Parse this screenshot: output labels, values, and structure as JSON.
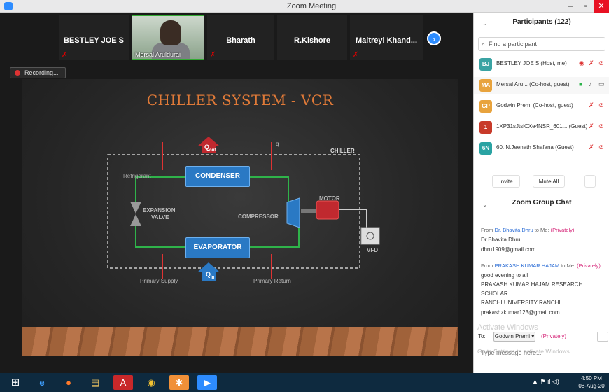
{
  "window": {
    "title": "Zoom Meeting"
  },
  "strip": {
    "tiles": [
      "BESTLEY JOE S",
      "Mersal Aruldurai",
      "Bharath",
      "R.Kishore",
      "Maitreyi  Khand..."
    ]
  },
  "recording": {
    "label": "Recording..."
  },
  "slide": {
    "title": "CHILLER SYSTEM - VCR",
    "chiller": "CHILLER",
    "refrigerant": "Refrigerant",
    "condenser": "CONDENSER",
    "evaporator": "EVAPORATOR",
    "expansion": "EXPANSION",
    "valve": "VALVE",
    "compressor": "COMPRESSOR",
    "motor": "MOTOR",
    "vfd": "VFD",
    "qout": "Q",
    "qout_sub": "out",
    "qin": "Q",
    "qin_sub": "in",
    "primary_supply": "Primary Supply",
    "primary_return": "Primary Return",
    "q_small": "q"
  },
  "participants": {
    "header": "Participants (122)",
    "search_placeholder": "Find a participant",
    "list": [
      {
        "initials": "BJ",
        "name": "BESTLEY JOE S (Host, me)",
        "color": "#3aa3a3"
      },
      {
        "initials": "MA",
        "name": "Mersal Aru... (Co-host, guest)",
        "color": "#e8a33d"
      },
      {
        "initials": "GP",
        "name": "Godwin Premi (Co-host, guest)",
        "color": "#e8a33d"
      },
      {
        "initials": "1",
        "name": "1XP31sJtslCXe4NSR_601... (Guest)",
        "color": "#c83a2a"
      },
      {
        "initials": "6N",
        "name": "60. N.Jeenath Shafana (Guest)",
        "color": "#2aa3a3"
      }
    ],
    "invite": "Invite",
    "mute_all": "Mute All",
    "more": "..."
  },
  "chat": {
    "header": "Zoom Group Chat",
    "messages": [
      {
        "from": "Dr. Bhavita Dhru",
        "lines": [
          "Dr.Bhavita Dhru",
          "dhru1909@gmail.com"
        ]
      },
      {
        "from": "PRAKASH KUMAR HAJAM",
        "lines": [
          "good evening to all",
          "PRAKASH KUMAR HAJAM RESEARCH",
          "SCHOLAR",
          " RANCHI UNIVERSITY RANCHI",
          "prakashzkumar123@gmail.com"
        ]
      }
    ],
    "from_label": "From",
    "to_label": "to Me:",
    "privately": "(Privately)",
    "to_prefix": "To:",
    "to_target": "Godwin Premi ▾",
    "input_placeholder": "Type message here...",
    "watermark": "Activate Windows",
    "watermark_sub": "Go to Settings to activate Windows."
  },
  "taskbar": {
    "time": "4:50 PM",
    "date": "08-Aug-20"
  },
  "colors": {
    "accent": "#2d8cff",
    "slide_title": "#e07a38"
  },
  "icons": [
    "start-icon",
    "ie-icon",
    "firefox-icon",
    "explorer-icon",
    "acrobat-icon",
    "chrome-icon",
    "app-icon",
    "zoom-icon"
  ]
}
